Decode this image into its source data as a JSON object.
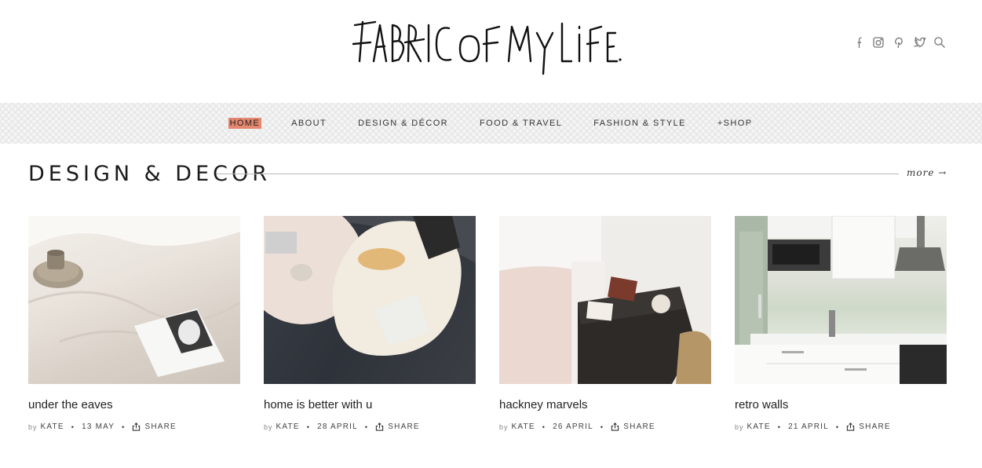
{
  "header": {
    "logo_text": "FABRIC OF MY LIFE.",
    "social_icons": [
      "facebook-icon",
      "instagram-icon",
      "pinterest-icon",
      "twitter-icon",
      "search-icon"
    ]
  },
  "nav": {
    "items": [
      {
        "label": "HOME",
        "active": true
      },
      {
        "label": "ABOUT",
        "active": false
      },
      {
        "label": "DESIGN & DÉCOR",
        "active": false
      },
      {
        "label": "FOOD & TRAVEL",
        "active": false
      },
      {
        "label": "FASHION & STYLE",
        "active": false
      },
      {
        "label": "+SHOP",
        "active": false
      }
    ],
    "active_color": "#e5876e"
  },
  "section": {
    "title": "DESIGN & DECOR",
    "more_label": "more →"
  },
  "posts": [
    {
      "title": "under the eaves",
      "by_label": "by",
      "author": "KATE",
      "date": "13 MAY",
      "share_label": "SHARE"
    },
    {
      "title": "home is better with u",
      "by_label": "by",
      "author": "KATE",
      "date": "28 APRIL",
      "share_label": "SHARE"
    },
    {
      "title": "hackney marvels",
      "by_label": "by",
      "author": "KATE",
      "date": "26 APRIL",
      "share_label": "SHARE"
    },
    {
      "title": "retro walls",
      "by_label": "by",
      "author": "KATE",
      "date": "21 APRIL",
      "share_label": "SHARE"
    }
  ]
}
